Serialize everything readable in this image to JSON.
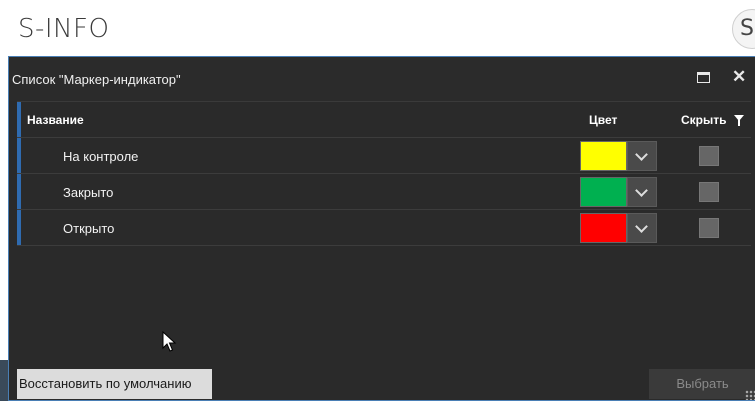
{
  "app": {
    "title": "S-INFO",
    "logo_letter": "S"
  },
  "dialog": {
    "title": "Список \"Маркер-индикатор\"",
    "columns": {
      "name": "Название",
      "color": "Цвет",
      "hide": "Скрыть"
    },
    "rows": [
      {
        "name": "На контроле",
        "color": "#ffff00",
        "hidden": false
      },
      {
        "name": "Закрыто",
        "color": "#00b050",
        "hidden": false
      },
      {
        "name": "Открыто",
        "color": "#ff0000",
        "hidden": false
      }
    ],
    "restore_label": "Восстановить по умолчанию",
    "select_label": "Выбрать"
  }
}
